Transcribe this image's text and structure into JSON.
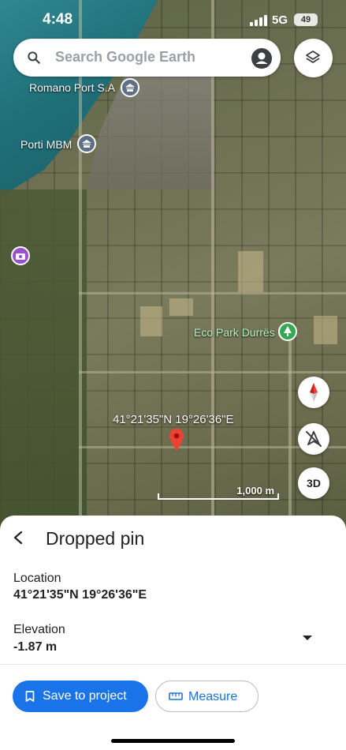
{
  "status_bar": {
    "time": "4:48",
    "network": "5G",
    "battery": "49"
  },
  "search": {
    "placeholder": "Search Google Earth",
    "icon": "search-icon"
  },
  "map": {
    "places": [
      {
        "name": "Romano Port S.A",
        "icon": "port-icon"
      },
      {
        "name": "Porti MBM",
        "icon": "port-icon"
      },
      {
        "name": "Eco Park Durrës",
        "icon": "tree-icon"
      }
    ],
    "pin_coordinates": "41°21'35\"N 19°26'36\"E",
    "scale": "1,000 m",
    "controls": {
      "compass": "compass-icon",
      "tilt": "no-location-icon",
      "mode_3d": "3D"
    }
  },
  "sheet": {
    "title": "Dropped pin",
    "location_label": "Location",
    "location_value": "41°21'35\"N 19°26'36\"E",
    "elevation_label": "Elevation",
    "elevation_value": "-1.87 m",
    "save_button": "Save to project",
    "measure_button": "Measure"
  },
  "colors": {
    "accent": "#1a73e8",
    "pin": "#ea4335",
    "place_icon": "#5f6f86",
    "eco_park": "#34a853"
  }
}
